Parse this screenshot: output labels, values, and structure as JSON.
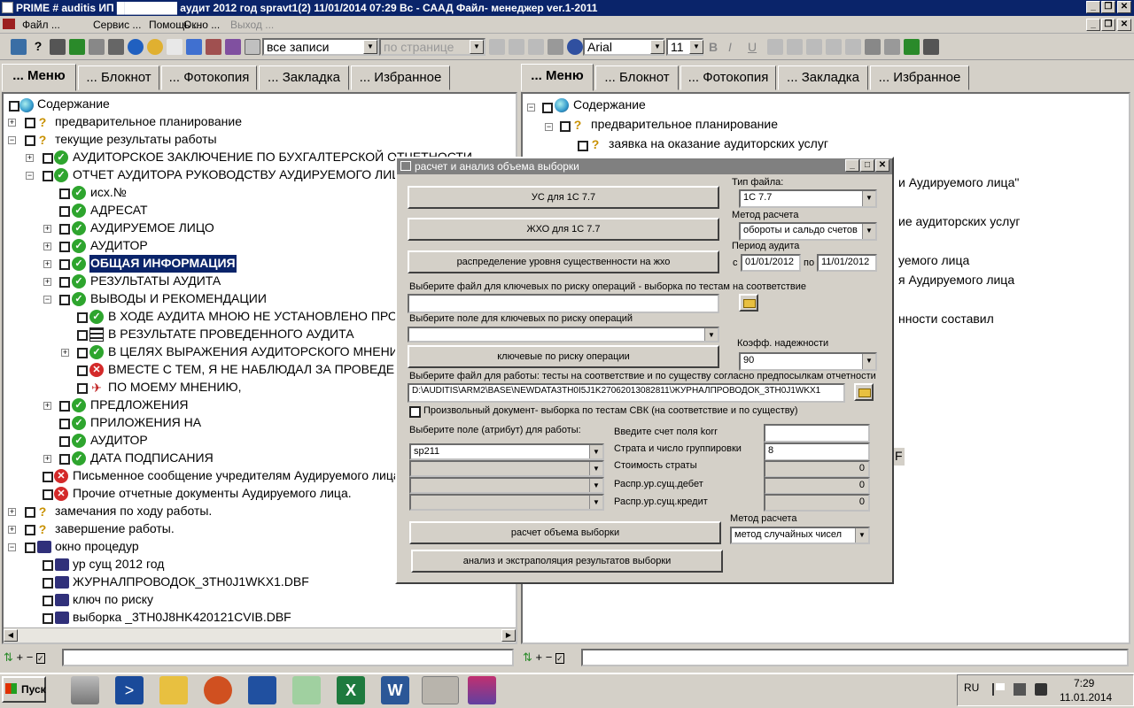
{
  "window": {
    "title": "PRIME # auditis ИП ████████ аудит 2012 год spravt1(2) 11/01/2014 07:29 Вс - СААД Файл- менеджер ver.1-2011",
    "min": "_",
    "restore": "❐",
    "close": "✕"
  },
  "menu": {
    "items": [
      "Файл ...",
      "Сервис ...",
      "Помощь ...",
      "Окно ...",
      "Выход ..."
    ]
  },
  "toolbar": {
    "records_select": "все записи",
    "per_page_select": "по странице",
    "font_select": "Arial",
    "size_select": "11",
    "bold": "B",
    "italic": "I",
    "underline": "U"
  },
  "left_tabs": [
    "... Меню",
    "... Блокнот",
    "... Фотокопия",
    "... Закладка",
    "... Избранное"
  ],
  "right_tabs": [
    "... Меню",
    "... Блокнот",
    "... Фотокопия",
    "... Закладка",
    "... Избранное"
  ],
  "left_tree": [
    {
      "label": "Содержание"
    },
    {
      "label": "предварительное планирование"
    },
    {
      "label": "текущие результаты работы"
    },
    {
      "label": "АУДИТОРСКОЕ ЗАКЛЮЧЕНИЕ ПО БУХГАЛТЕРСКОЙ ОТЧЕТНОСТИ"
    },
    {
      "label": "ОТЧЕТ АУДИТОРА РУКОВОДСТВУ АУДИРУЕМОГО ЛИЦА"
    },
    {
      "label": "исх.№"
    },
    {
      "label": "АДРЕСАТ"
    },
    {
      "label": "АУДИРУЕМОЕ ЛИЦО"
    },
    {
      "label": "АУДИТОР"
    },
    {
      "label": "ОБЩАЯ ИНФОРМАЦИЯ"
    },
    {
      "label": "РЕЗУЛЬТАТЫ АУДИТА"
    },
    {
      "label": "ВЫВОДЫ И РЕКОМЕНДАЦИИ"
    },
    {
      "label": "В ХОДЕ АУДИТА МНОЮ НЕ УСТАНОВЛЕНО ПРОБЛЕМ"
    },
    {
      "label": "В  РЕЗУЛЬТАТЕ  ПРОВЕДЕННОГО  АУДИТА"
    },
    {
      "label": "В ЦЕЛЯХ ВЫРАЖЕНИЯ АУДИТОРСКОГО МНЕНИЯ"
    },
    {
      "label": "ВМЕСТЕ С ТЕМ, Я НЕ НАБЛЮДАЛ ЗА ПРОВЕДЕНИЕМ"
    },
    {
      "label": "ПО МОЕМУ МНЕНИЮ,"
    },
    {
      "label": "ПРЕДЛОЖЕНИЯ"
    },
    {
      "label": "ПРИЛОЖЕНИЯ НА"
    },
    {
      "label": "АУДИТОР"
    },
    {
      "label": "ДАТА ПОДПИСАНИЯ"
    },
    {
      "label": "Письменное сообщение учредителям Аудируемого лица"
    },
    {
      "label": "Прочие отчетные документы Аудируемого лица."
    },
    {
      "label": "замечания по ходу работы."
    },
    {
      "label": "завершение работы."
    },
    {
      "label": "окно процедур"
    },
    {
      "label": "ур сущ 2012 год"
    },
    {
      "label": "ЖУРНАЛПРОВОДОК_3TH0J1WKX1.DBF"
    },
    {
      "label": "ключ по риску"
    },
    {
      "label": "выборка _3TH0J8HK420121CVIB.DBF"
    }
  ],
  "right_tree": [
    {
      "label": "Содержание"
    },
    {
      "label": "предварительное планирование"
    },
    {
      "label": "заявка на оказание аудиторских услуг"
    }
  ],
  "right_partial": [
    "и Аудируемого лица\"",
    "ие аудиторских услуг",
    "уемого лица",
    "я Аудируемого лица",
    "нности составил",
    "F"
  ],
  "dialog": {
    "title": "расчет и анализ объема выборки",
    "btn_us": "УС для 1С 7.7",
    "btn_jho": "ЖХО для 1С 7.7",
    "btn_distribution": "распределение уровня существенности на жхо",
    "file_type_label": "Тип файла:",
    "file_type_value": "1С 7.7",
    "calc_method_label": "Метод расчета",
    "calc_method_value": "обороты и сальдо счетов",
    "audit_period_label": "Период аудита",
    "period_from_label": "с",
    "period_from": "01/01/2012",
    "period_to_label": "по",
    "period_to": "11/01/2012",
    "key_file_label": "Выберите файл для ключевых по риску операций - выборка по тестам на соответствие",
    "key_file_value": "",
    "key_field_label": "Выберите поле для ключевых по риску операций",
    "key_field_value": "",
    "btn_key_risk": "ключевые по риску операции",
    "reliability_label": "Коэфф. надежности",
    "reliability_value": "90",
    "work_file_label": "Выберите файл для работы: тесты на соответствие и по существу согласно предпосылкам отчетности",
    "work_file_value": "D:\\AUDITIS\\ARM2\\BASE\\NEWDATA3TH0I5J1K27062013082811\\ЖУРНАЛПРОВОДОК_3TH0J1WKX1",
    "arbitrary_doc_label": "Произвольный документ- выборка по тестам СВК (на соответствие и по существу)",
    "field_attr_label": "Выберите поле (атрибут)  для работы:",
    "field_attr_value": "sp211",
    "korr_label": "Введите счет поля korr",
    "korr_value": "",
    "strata_label": "Страта и число группировки",
    "strata_value": "8",
    "strata_cost_label": "Стоимость страты",
    "strata_cost_value": "0",
    "debit_label": "Распр.ур.сущ.дебет",
    "debit_value": "0",
    "credit_label": "Распр.ур.сущ.кредит",
    "credit_value": "0",
    "calc_method2_label": "Метод расчета",
    "calc_method2_value": "метод случайных чисел",
    "btn_calc_sample": "расчет объема выборки",
    "btn_analysis": "анализ и экстраполяция результатов выборки"
  },
  "statusbar": {
    "left_icons": "+ −",
    "right_icons": "+ −"
  },
  "taskbar": {
    "start": "Пуск",
    "lang": "RU",
    "time": "7:29",
    "date": "11.01.2014"
  }
}
